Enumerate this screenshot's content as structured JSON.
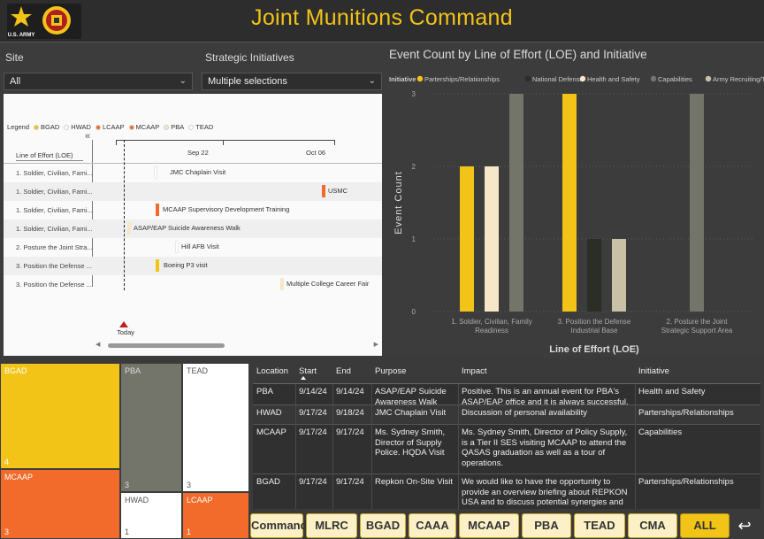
{
  "header": {
    "title": "Joint Munitions Command",
    "logo_text": "U.S. ARMY"
  },
  "slicers": {
    "site_label": "Site",
    "site_value": "All",
    "initiatives_label": "Strategic Initiatives",
    "initiatives_value": "Multiple selections"
  },
  "gantt": {
    "legend_title": "Legend",
    "legend": [
      {
        "name": "BGAD",
        "color": "#f2c418"
      },
      {
        "name": "HWAD",
        "color": "#ffffff"
      },
      {
        "name": "LCAAP",
        "color": "#f26b2a"
      },
      {
        "name": "MCAAP",
        "color": "#f26b2a"
      },
      {
        "name": "PBA",
        "color": "#f5e7c8"
      },
      {
        "name": "TEAD",
        "color": "#ffffff"
      }
    ],
    "collapse_icon": "«",
    "loe_header": "Line of Effort (LOE)",
    "date_ticks": [
      "Sep 22",
      "Oct 06"
    ],
    "today_label": "Today",
    "rows": [
      {
        "label": "1. Soldier, Civilian, Fami...",
        "event": "JMC Chaplain Visit",
        "color": "#ffffff"
      },
      {
        "label": "1. Soldier, Civilian, Fami...",
        "event": "USMC",
        "color": "#f26b2a"
      },
      {
        "label": "1. Soldier, Civilian, Fami...",
        "event": "MCAAP Supervisory Development Training",
        "color": "#f26b2a"
      },
      {
        "label": "1. Soldier, Civilian, Fami...",
        "event": "ASAP/EAP Suicide Awareness Walk",
        "color": "#f5e7c8"
      },
      {
        "label": "2. Posture the Joint Stra...",
        "event": "Hill AFB Visit",
        "color": "#ffffff"
      },
      {
        "label": "3. Position the Defense ...",
        "event": "Boeing P3 visit",
        "color": "#f2c418"
      },
      {
        "label": "3. Position the Defense ...",
        "event": "Multiple College Career Fair",
        "color": "#f5e7c8"
      }
    ]
  },
  "chart_data": {
    "type": "bar",
    "title": "Event Count by Line of Effort (LOE) and Initiative",
    "legend_title": "Initiative",
    "xlabel": "Line of Effort (LOE)",
    "ylabel": "Event Count",
    "ylim": [
      0,
      3
    ],
    "yticks": [
      "0",
      "1",
      "2",
      "3"
    ],
    "categories": [
      "1. Soldier, Civilian, Family Readiness",
      "3. Position the Defense Industrial Base",
      "2. Posture the Joint Strategic Support Area"
    ],
    "category_lines": [
      [
        "1. Soldier, Civilian, Family",
        "Readiness"
      ],
      [
        "3. Position the Defense",
        "Industrial Base"
      ],
      [
        "2. Posture the Joint",
        "Strategic Support Area"
      ]
    ],
    "series": [
      {
        "name": "Parterships/Relationships",
        "color": "#f2c418",
        "values": [
          2,
          3,
          0
        ]
      },
      {
        "name": "National Defense",
        "color": "#2b2e27",
        "values": [
          0,
          1,
          0
        ]
      },
      {
        "name": "Health and Safety",
        "color": "#f5e7c8",
        "values": [
          2,
          0,
          0
        ]
      },
      {
        "name": "Capabilities",
        "color": "#74756a",
        "values": [
          3,
          0,
          3
        ]
      },
      {
        "name": "Army Recruiting/Transi...",
        "color": "#c9c0a8",
        "values": [
          0,
          1,
          0
        ]
      }
    ],
    "grid": true,
    "legend_position": "top"
  },
  "treemap": [
    {
      "name": "BGAD",
      "value": "4",
      "color": "#f2c418",
      "text": "#ffffff"
    },
    {
      "name": "PBA",
      "value": "3",
      "color": "#74756a",
      "text": "#dddddd"
    },
    {
      "name": "TEAD",
      "value": "3",
      "color": "#ffffff",
      "text": "#555555"
    },
    {
      "name": "MCAAP",
      "value": "3",
      "color": "#f26b2a",
      "text": "#ffffff"
    },
    {
      "name": "HWAD",
      "value": "1",
      "color": "#ffffff",
      "text": "#555555"
    },
    {
      "name": "LCAAP",
      "value": "1",
      "color": "#f26b2a",
      "text": "#ffffff"
    }
  ],
  "table": {
    "columns": [
      "Location",
      "Start",
      "End",
      "Purpose",
      "Impact",
      "Initiative"
    ],
    "rows": [
      {
        "location": "PBA",
        "start": "9/14/24",
        "end": "9/14/24",
        "purpose": "ASAP/EAP Suicide Awareness Walk",
        "impact": "Positive. This is an annual event for PBA's ASAP/EAP office and it is always successful.",
        "initiative": "Health and Safety"
      },
      {
        "location": "HWAD",
        "start": "9/17/24",
        "end": "9/18/24",
        "purpose": "JMC Chaplain Visit",
        "impact": "Discussion of personal availability",
        "initiative": "Parterships/Relationships"
      },
      {
        "location": "MCAAP",
        "start": "9/17/24",
        "end": "9/17/24",
        "purpose": "Ms. Sydney Smith, Director of Supply Police. HQDA Visit",
        "impact": "Ms. Sydney Smith, Director of Policy Supply, is a Tier II SES visiting MCAAP to attend the QASAS graduation as well as a tour of operations.",
        "initiative": "Capabilities"
      },
      {
        "location": "BGAD",
        "start": "9/17/24",
        "end": "9/17/24",
        "purpose": "Repkon On-Site Visit",
        "impact": "We would like to have the opportunity to provide an overview briefing about REPKON USA and to discuss potential synergies and",
        "initiative": "Parterships/Relationships"
      }
    ]
  },
  "nav": {
    "buttons": [
      "Command",
      "MLRC",
      "BGAD",
      "CAAA",
      "MCAAP",
      "PBA",
      "TEAD",
      "CMA",
      "ALL"
    ],
    "active": "ALL",
    "back_icon": "↩"
  }
}
